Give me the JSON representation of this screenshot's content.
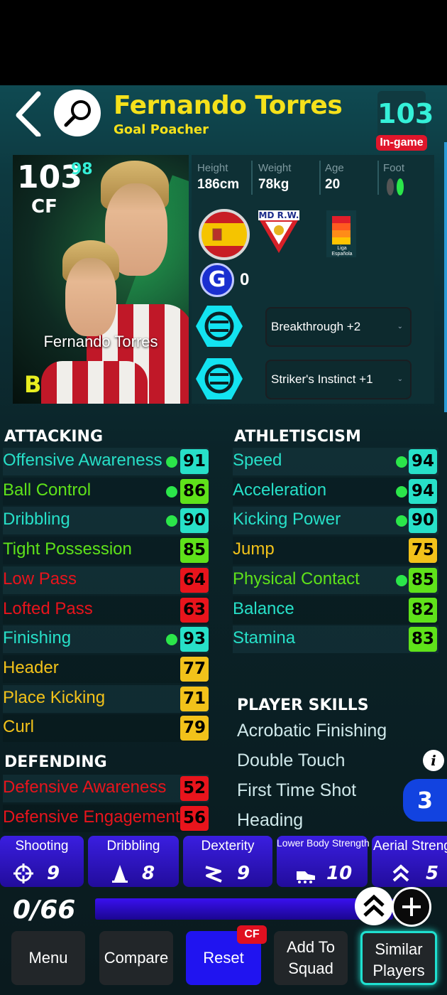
{
  "header": {
    "player_name": "Fernando Torres",
    "playing_style": "Goal Poacher",
    "overall": "103",
    "overall_tag": "In-game"
  },
  "card": {
    "overall": "103",
    "max_overall": "98",
    "position": "CF",
    "name": "Fernando Torres",
    "condition": "B"
  },
  "info": {
    "height_label": "Height",
    "height": "186cm",
    "weight_label": "Weight",
    "weight": "78kg",
    "age_label": "Age",
    "age": "20",
    "foot_label": "Foot",
    "club_text": "MD R.W.",
    "league_text": "Liga Española",
    "g_badge": "G",
    "g_count": "0",
    "boosters": [
      "Breakthrough +2",
      "Striker's Instinct +1"
    ]
  },
  "attacking": {
    "title": "ATTACKING",
    "stats": [
      {
        "name": "Offensive Awareness",
        "value": "91",
        "color": "#27e0c8",
        "name_color": "#27e0c8",
        "dot": true
      },
      {
        "name": "Ball Control",
        "value": "86",
        "color": "#5fe21a",
        "name_color": "#5fe21a",
        "dot": true
      },
      {
        "name": "Dribbling",
        "value": "90",
        "color": "#27e0c8",
        "name_color": "#27e0c8",
        "dot": true
      },
      {
        "name": "Tight Possession",
        "value": "85",
        "color": "#5fe21a",
        "name_color": "#5fe21a",
        "dot": false
      },
      {
        "name": "Low Pass",
        "value": "64",
        "color": "#e8141c",
        "name_color": "#e8141c",
        "dot": false
      },
      {
        "name": "Lofted Pass",
        "value": "63",
        "color": "#e8141c",
        "name_color": "#e8141c",
        "dot": false
      },
      {
        "name": "Finishing",
        "value": "93",
        "color": "#27e0c8",
        "name_color": "#27e0c8",
        "dot": true
      },
      {
        "name": "Header",
        "value": "77",
        "color": "#f2c21a",
        "name_color": "#f2c21a",
        "dot": false
      },
      {
        "name": "Place Kicking",
        "value": "71",
        "color": "#f2c21a",
        "name_color": "#f2c21a",
        "dot": false
      },
      {
        "name": "Curl",
        "value": "79",
        "color": "#f2c21a",
        "name_color": "#f2c21a",
        "dot": false
      }
    ]
  },
  "defending": {
    "title": "DEFENDING",
    "stats": [
      {
        "name": "Defensive Awareness",
        "value": "52",
        "color": "#e8141c",
        "name_color": "#e8141c"
      },
      {
        "name": "Defensive Engagement",
        "value": "56",
        "color": "#e8141c",
        "name_color": "#e8141c"
      }
    ]
  },
  "athleticism": {
    "title": "ATHLETISCISM",
    "stats": [
      {
        "name": "Speed",
        "value": "94",
        "color": "#27e0c8",
        "name_color": "#27e0c8",
        "dot": true
      },
      {
        "name": "Acceleration",
        "value": "94",
        "color": "#27e0c8",
        "name_color": "#27e0c8",
        "dot": true
      },
      {
        "name": "Kicking Power",
        "value": "90",
        "color": "#27e0c8",
        "name_color": "#27e0c8",
        "dot": true
      },
      {
        "name": "Jump",
        "value": "75",
        "color": "#f2c21a",
        "name_color": "#f2c21a",
        "dot": false
      },
      {
        "name": "Physical Contact",
        "value": "85",
        "color": "#5fe21a",
        "name_color": "#5fe21a",
        "dot": true
      },
      {
        "name": "Balance",
        "value": "82",
        "color": "#5fe21a",
        "name_color": "#27e0c8",
        "dot": false
      },
      {
        "name": "Stamina",
        "value": "83",
        "color": "#5fe21a",
        "name_color": "#27e0c8",
        "dot": false
      }
    ]
  },
  "skills": {
    "title": "PLAYER SKILLS",
    "items": [
      "Acrobatic Finishing",
      "Double Touch",
      "First Time Shot",
      "Heading"
    ],
    "count": "3"
  },
  "progression": [
    {
      "label": "Shooting",
      "value": "9",
      "icon": "crosshair-icon"
    },
    {
      "label": "Dribbling",
      "value": "8",
      "icon": "cone-icon"
    },
    {
      "label": "Dexterity",
      "value": "9",
      "icon": "zigzag-icon"
    },
    {
      "label": "Lower Body Strength",
      "value": "10",
      "icon": "boot-icon"
    },
    {
      "label": "Aerial Streng",
      "value": "5",
      "icon": "double-chevron-up-icon"
    }
  ],
  "points": {
    "text": "0/66"
  },
  "buttons": {
    "menu": "Menu",
    "compare": "Compare",
    "reset": "Reset",
    "reset_tag": "CF",
    "add_to_squad_line1": "Add To",
    "add_to_squad_line2": "Squad",
    "similar_line1": "Similar",
    "similar_line2": "Players"
  }
}
